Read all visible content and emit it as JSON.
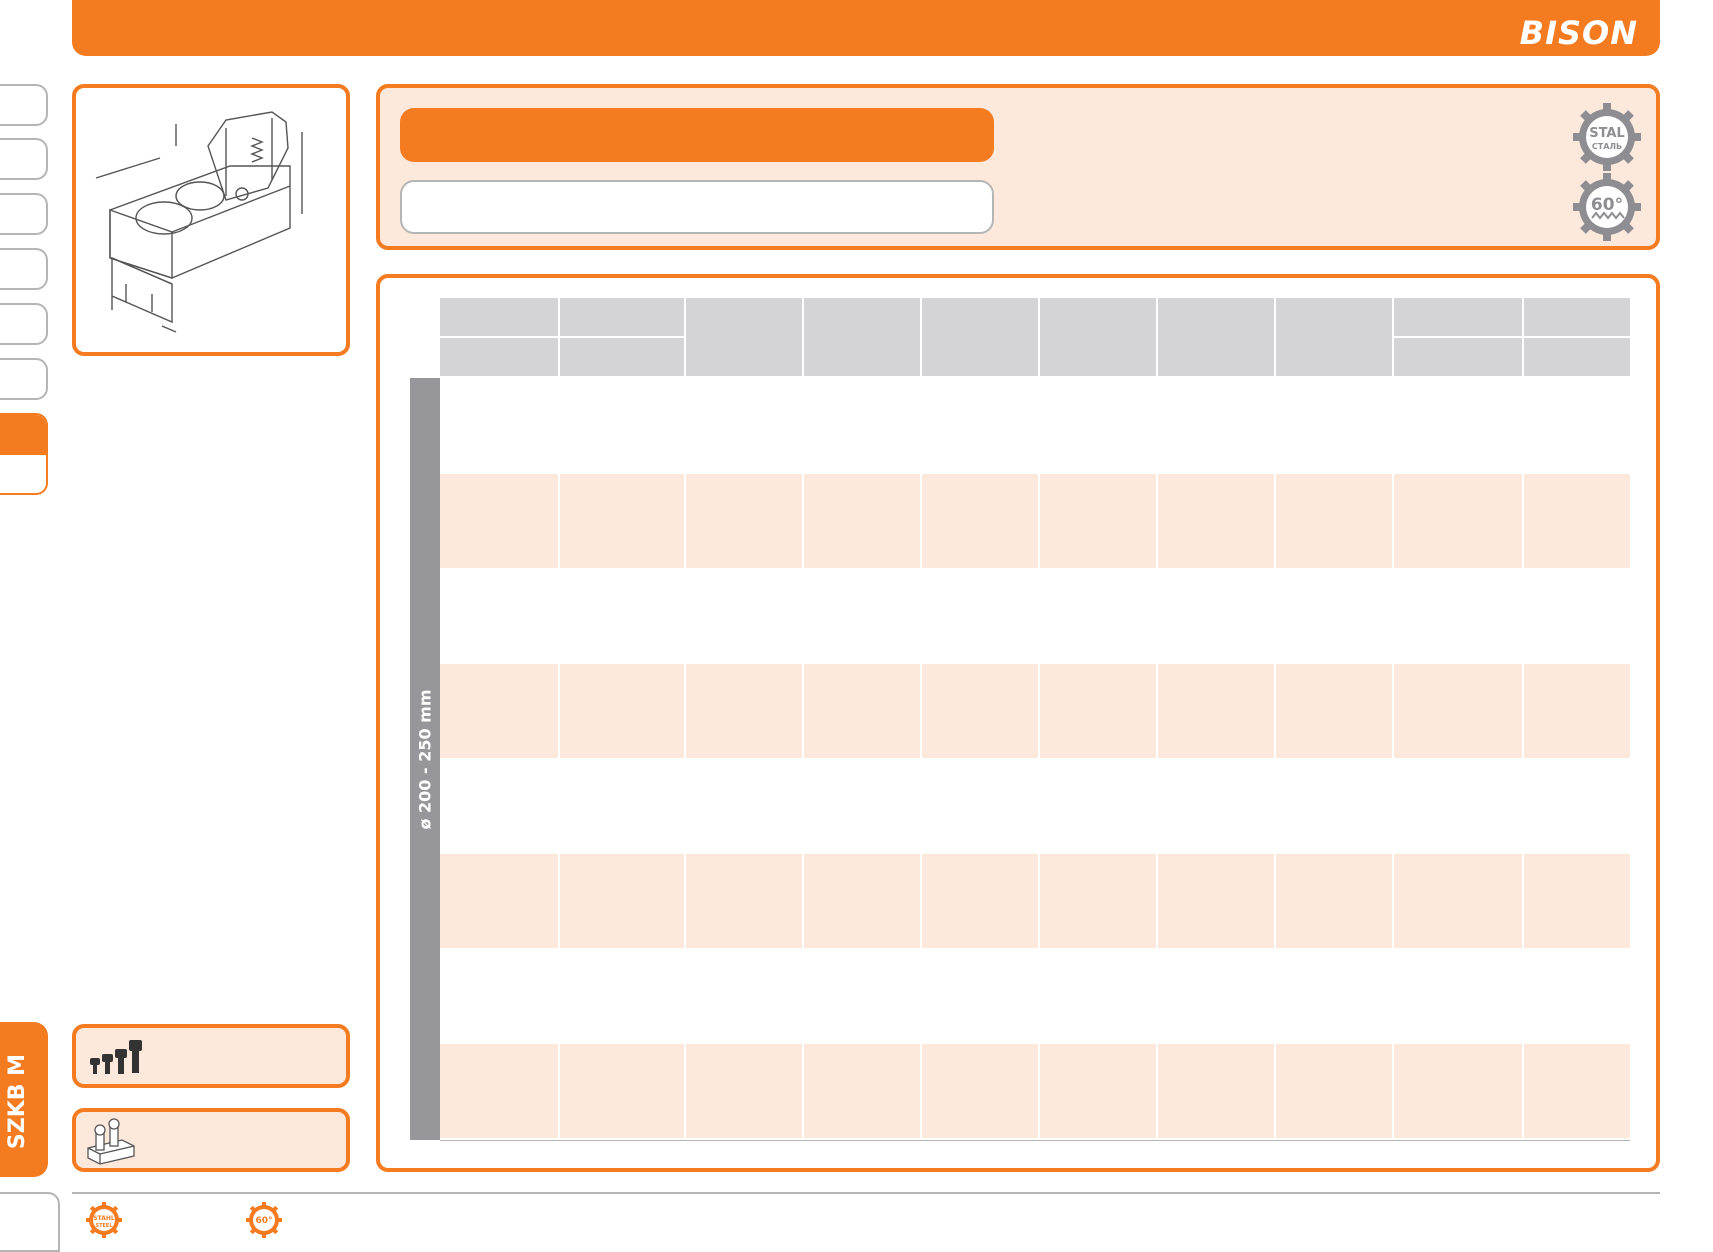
{
  "brand": {
    "logo": "BISON"
  },
  "side_tab": {
    "label": "SZKB M"
  },
  "table": {
    "range_label": "ø 200 - 250 mm"
  },
  "badges": [
    {
      "icon": "steel-gear-icon",
      "text": "STAL",
      "subtext": "СТАЛЬ"
    },
    {
      "icon": "sixty-degree-gear-icon",
      "text": "60°"
    }
  ],
  "footer": {
    "badges": [
      {
        "icon": "stahl-steel-small-icon",
        "text": "STAHL",
        "subtext": "STEEL"
      },
      {
        "icon": "sixty-degree-small-icon",
        "text": "60°"
      }
    ]
  },
  "colors": {
    "accent": "#f47b20",
    "band": "#fde9dc",
    "header_gray": "#d4d4d6",
    "range_gray": "#97979b"
  }
}
